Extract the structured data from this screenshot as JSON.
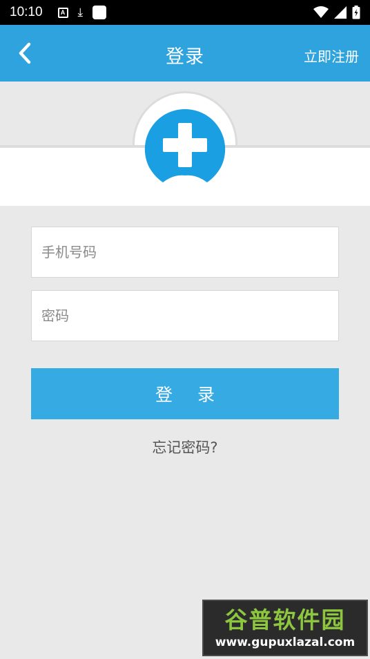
{
  "status_bar": {
    "time": "10:10",
    "icons_left": [
      "a-notification-icon",
      "download-icon",
      "app-icon"
    ],
    "icons_right": [
      "wifi-icon",
      "signal-icon",
      "battery-icon"
    ]
  },
  "app_bar": {
    "title": "登录",
    "register_label": "立即注册",
    "background_color": "#2ea3de"
  },
  "logo": {
    "icon": "medical-cross-logo-icon",
    "color": "#1aa0e2"
  },
  "form": {
    "phone_placeholder": "手机号码",
    "password_placeholder": "密码",
    "login_label": "登 录",
    "login_color": "#35aae3",
    "forgot_label": "忘记密码?"
  },
  "watermark": {
    "title": "谷普软件园",
    "url": "www.gupuxlazal.com"
  }
}
